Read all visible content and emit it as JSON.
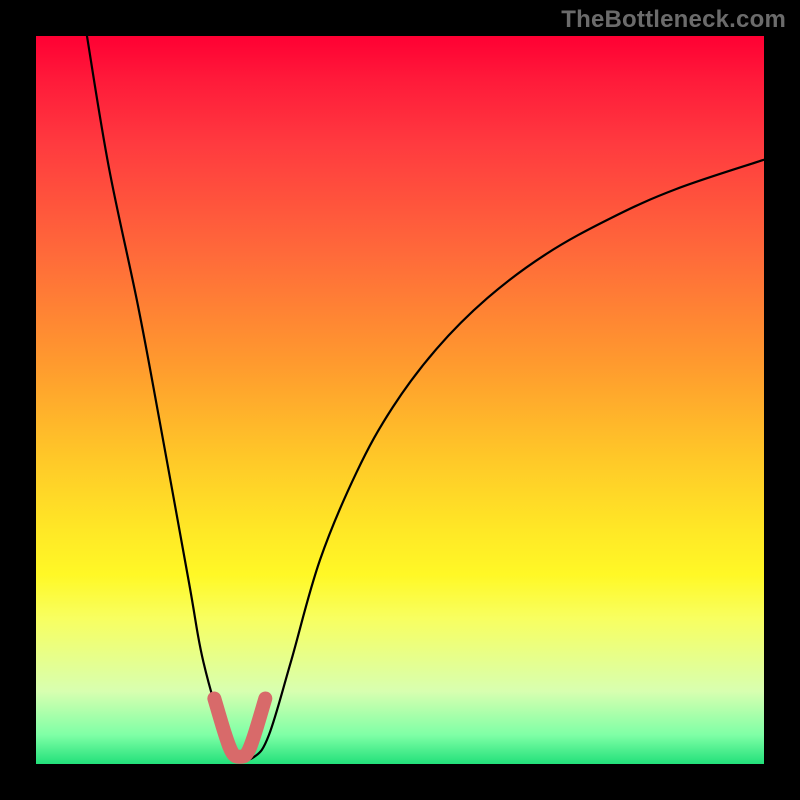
{
  "watermark": {
    "text": "TheBottleneck.com"
  },
  "chart_data": {
    "type": "line",
    "title": "",
    "xlabel": "",
    "ylabel": "",
    "xlim": [
      0,
      100
    ],
    "ylim": [
      0,
      100
    ],
    "grid": false,
    "series": [
      {
        "name": "bottleneck-curve",
        "x": [
          7,
          10,
          14,
          17,
          21,
          23,
          26,
          28,
          30,
          32,
          35,
          39,
          44,
          49,
          55,
          62,
          70,
          79,
          88,
          100
        ],
        "y": [
          100,
          82,
          63,
          47,
          25,
          14,
          4,
          1,
          1,
          4,
          14,
          28,
          40,
          49,
          57,
          64,
          70,
          75,
          79,
          83
        ]
      }
    ],
    "highlight": {
      "name": "trough-marker",
      "color": "#d86a6a",
      "x": [
        24.5,
        26,
        27,
        28,
        29,
        30,
        31.5
      ],
      "y": [
        9,
        4,
        1.5,
        1,
        1.5,
        4,
        9
      ]
    },
    "background": "rainbow-vertical-gradient"
  }
}
